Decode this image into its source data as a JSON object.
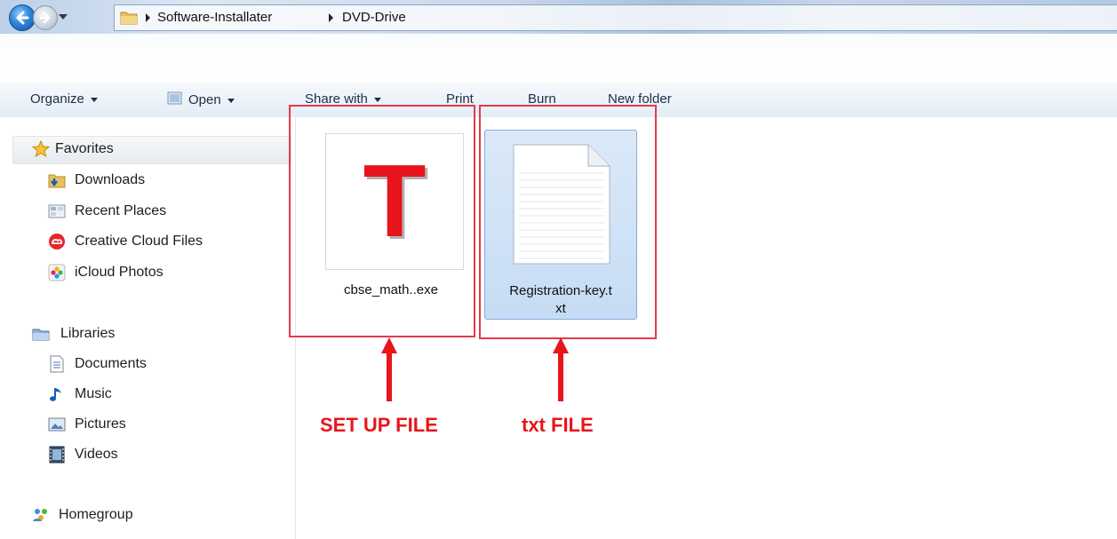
{
  "window": {
    "breadcrumb": [
      "Software-Installater",
      "DVD-Drive"
    ]
  },
  "toolbar": {
    "organize": "Organize",
    "open": "Open",
    "share_with": "Share with",
    "print": "Print",
    "burn": "Burn",
    "new_folder": "New folder"
  },
  "sidebar": {
    "favorites": {
      "label": "Favorites",
      "items": [
        "Downloads",
        "Recent Places",
        "Creative Cloud Files",
        "iCloud Photos"
      ]
    },
    "libraries": {
      "label": "Libraries",
      "items": [
        "Documents",
        "Music",
        "Pictures",
        "Videos"
      ]
    },
    "homegroup": "Homegroup"
  },
  "files": [
    {
      "name": "cbse_math..exe",
      "icon": "T",
      "icon_color": "#e8141c",
      "selected": false
    },
    {
      "name_line1": "Registration-key.t",
      "name_line2": "xt",
      "icon": "text-file-icon",
      "selected": true
    }
  ],
  "annotations": {
    "setup_label": "SET UP FILE",
    "txt_label": "txt FILE",
    "color": "#e8151b"
  }
}
